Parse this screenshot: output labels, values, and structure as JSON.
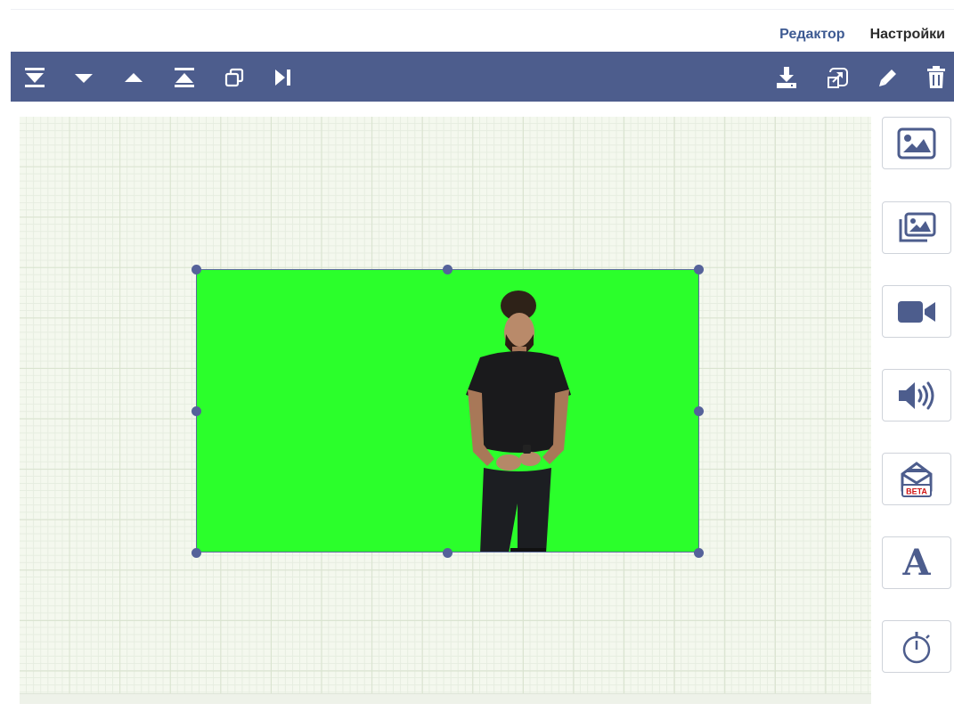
{
  "header": {
    "tabs": [
      {
        "label": "Редактор",
        "active": true
      },
      {
        "label": "Настройки",
        "active": false
      }
    ]
  },
  "toolbar": {
    "left_buttons": [
      {
        "icon": "move-to-bottom-icon"
      },
      {
        "icon": "move-down-icon"
      },
      {
        "icon": "move-up-icon"
      },
      {
        "icon": "move-to-top-icon"
      },
      {
        "icon": "duplicate-icon"
      },
      {
        "icon": "step-forward-icon"
      }
    ],
    "right_buttons": [
      {
        "icon": "download-icon"
      },
      {
        "icon": "resize-icon"
      },
      {
        "icon": "pencil-icon"
      },
      {
        "icon": "trash-icon"
      }
    ],
    "background_color": "#4d5d8d"
  },
  "canvas": {
    "selected_element": {
      "type": "video-frame",
      "background_color": "#2bff2b"
    }
  },
  "tool_panel": {
    "items": [
      {
        "icon": "image-icon"
      },
      {
        "icon": "gallery-icon"
      },
      {
        "icon": "video-camera-icon"
      },
      {
        "icon": "speaker-icon"
      },
      {
        "icon": "envelope-beta-icon",
        "badge": "BETA"
      },
      {
        "icon": "text-icon",
        "glyph": "A"
      },
      {
        "icon": "timer-icon"
      }
    ],
    "accent_color": "#4d5d8d"
  }
}
